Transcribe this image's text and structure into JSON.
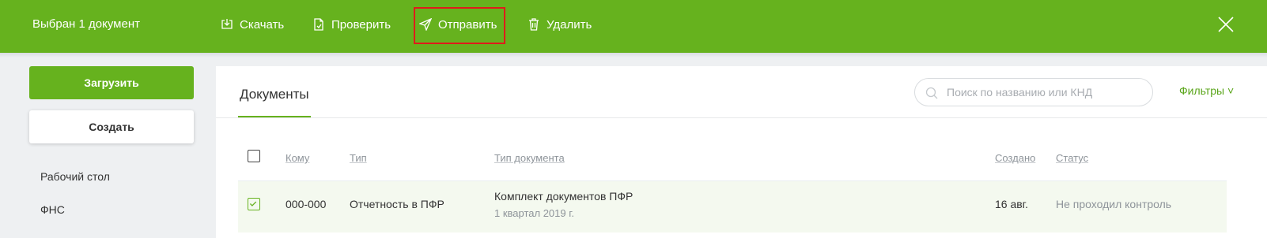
{
  "topbar": {
    "selected_text": "Выбран 1 документ",
    "actions": [
      {
        "label": "Скачать",
        "icon": "download-icon"
      },
      {
        "label": "Проверить",
        "icon": "check-doc-icon"
      },
      {
        "label": "Отправить",
        "icon": "send-icon"
      },
      {
        "label": "Удалить",
        "icon": "trash-icon"
      }
    ],
    "highlight_color": "#e01b1b"
  },
  "sidebar": {
    "upload_label": "Загрузить",
    "create_label": "Создать",
    "items": [
      {
        "label": "Рабочий стол"
      },
      {
        "label": "ФНС"
      }
    ]
  },
  "main": {
    "tab_label": "Документы",
    "search_placeholder": "Поиск по названию или КНД",
    "filters_label": "Фильтры ˅",
    "columns": [
      "Кому",
      "Тип",
      "Тип документа",
      "Создано",
      "Статус"
    ],
    "rows": [
      {
        "checked": true,
        "to": "000-000",
        "type": "Отчетность в ПФР",
        "doc_type": "Комплект документов ПФР",
        "doc_sub": "1 квартал 2019 г.",
        "created": "16 авг.",
        "status": "Не проходил контроль"
      }
    ]
  },
  "colors": {
    "brand_green": "#66b21e",
    "background": "#eef0f2"
  }
}
